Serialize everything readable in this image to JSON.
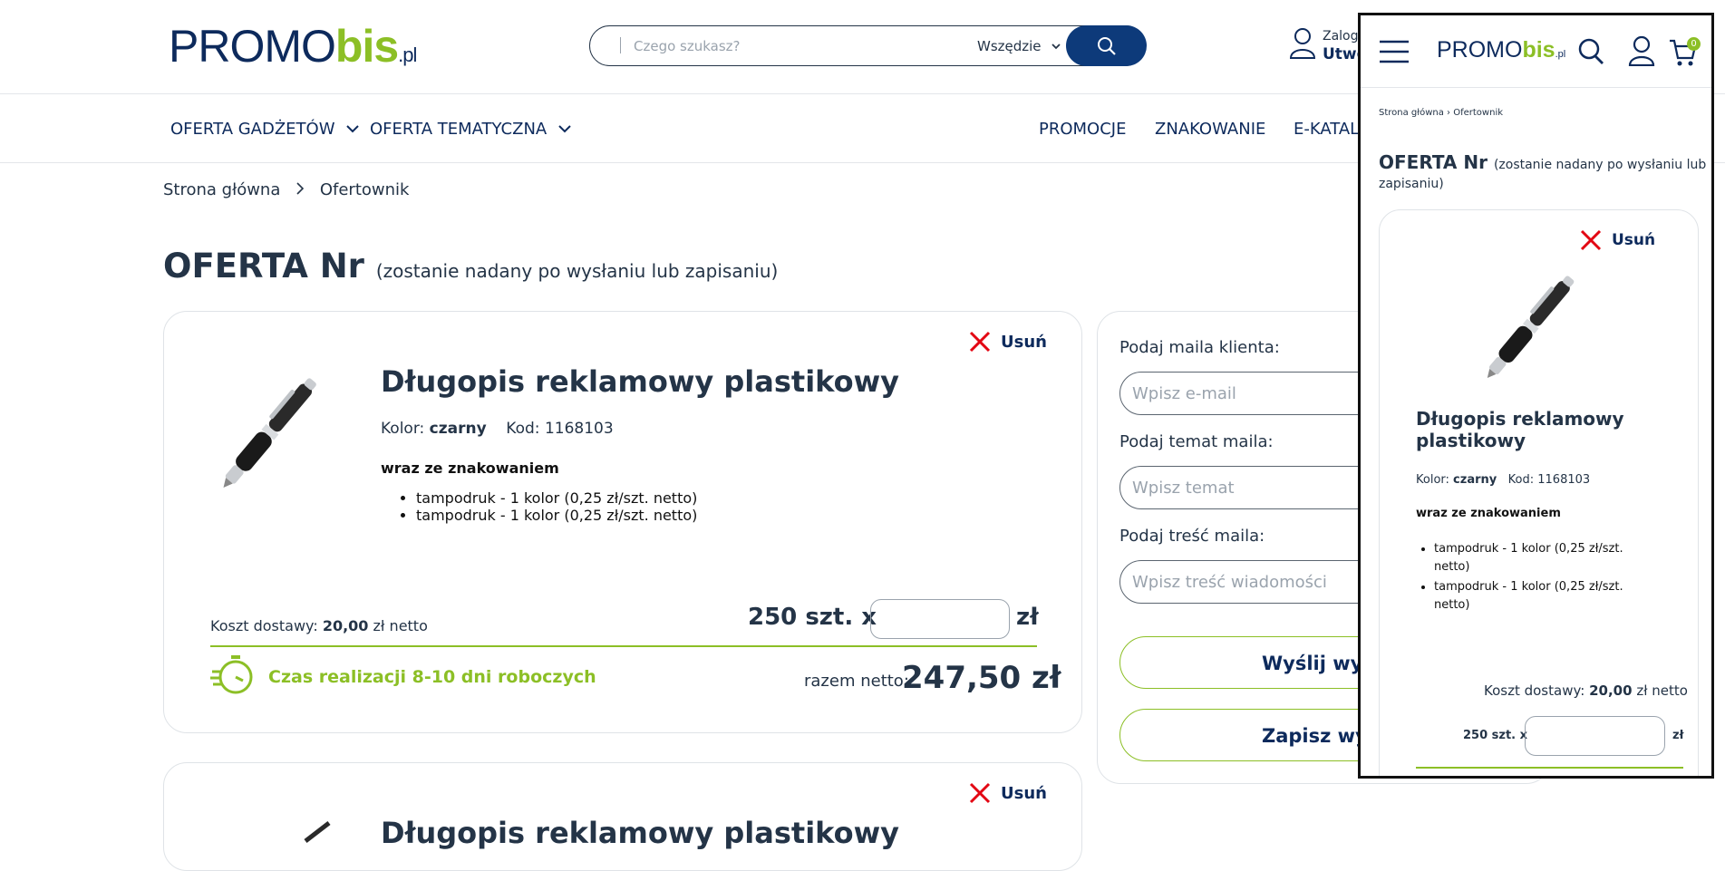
{
  "header": {
    "logo": {
      "promo": "PROMO",
      "bis": "bis",
      "pl": ".pl"
    },
    "search": {
      "placeholder": "Czego szukasz?",
      "scope": "Wszędzie",
      "search_icon": "search-icon"
    },
    "user": {
      "line1": "Zalogu",
      "line2": "Utwó"
    }
  },
  "nav": {
    "left": [
      "OFERTA GADŻETÓW",
      "OFERTA TEMATYCZNA"
    ],
    "right": [
      "PROMOCJE",
      "ZNAKOWANIE",
      "E-KATALOG"
    ]
  },
  "breadcrumb": {
    "home": "Strona główna",
    "current": "Ofertownik"
  },
  "page": {
    "title": "OFERTA Nr",
    "subtitle": "(zostanie nadany po wysłaniu lub zapisaniu)"
  },
  "products": [
    {
      "remove_label": "Usuń",
      "name": "Długopis reklamowy plastikowy",
      "color_label": "Kolor:",
      "color": "czarny",
      "code_label": "Kod:",
      "code": "1168103",
      "marking_heading": "wraz ze znakowaniem",
      "markings": [
        "tampodruk - 1 kolor (0,25 zł/szt. netto)",
        "tampodruk - 1 kolor (0,25 zł/szt. netto)"
      ],
      "shipping_label": "Koszt dostawy:",
      "shipping_value": "20,00",
      "shipping_unit": "zł netto",
      "qty_text": "250 szt. x",
      "currency": "zł",
      "lead_time": "Czas realizacji 8-10 dni roboczych",
      "total_label": "razem netto:",
      "total_value": "247,50 zł"
    },
    {
      "remove_label": "Usuń",
      "name": "Długopis reklamowy plastikowy"
    }
  ],
  "form": {
    "email_label": "Podaj maila klienta:",
    "email_placeholder": "Wpisz e-mail",
    "subject_label": "Podaj temat maila:",
    "subject_placeholder": "Wpisz temat",
    "body_label": "Podaj treść maila:",
    "body_placeholder": "Wpisz treść wiadomości",
    "send_label": "Wyślij wyc",
    "save_label": "Zapisz wyc"
  },
  "mobile": {
    "logo": {
      "promo": "PROMO",
      "bis": "bis",
      "pl": ".pl"
    },
    "cart_count": "0",
    "breadcrumb": {
      "home": "Strona główna",
      "current": "Ofertownik"
    },
    "title": "OFERTA Nr",
    "subtitle_a": "(zostanie nadany po wysłaniu lub",
    "subtitle_b": "zapisaniu)",
    "remove_label": "Usuń",
    "name_a": "Długopis reklamowy",
    "name_b": "plastikowy",
    "color_label": "Kolor:",
    "color": "czarny",
    "code_label": "Kod:",
    "code": "1168103",
    "marking_heading": "wraz ze znakowaniem",
    "marking_a1": "tampodruk - 1 kolor (0,25 zł/szt.",
    "marking_a2": "netto)",
    "marking_b1": "tampodruk - 1 kolor (0,25 zł/szt.",
    "marking_b2": "netto)",
    "shipping_label": "Koszt dostawy:",
    "shipping_value": "20,00",
    "shipping_unit": "zł netto",
    "qty_text": "250 szt. x",
    "currency": "zł"
  },
  "colors": {
    "navy": "#0d2a5c",
    "green": "#8cbf26",
    "red": "#e30613",
    "text": "#243447"
  }
}
